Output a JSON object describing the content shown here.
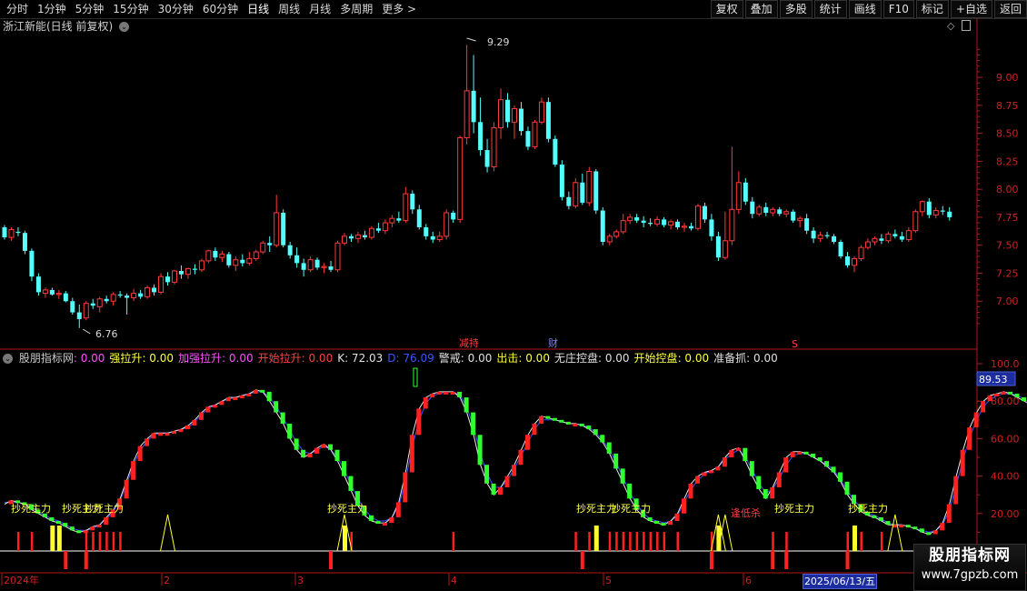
{
  "toolbar": {
    "periods": [
      "分时",
      "1分钟",
      "5分钟",
      "15分钟",
      "30分钟",
      "60分钟",
      "日线",
      "周线",
      "月线",
      "多周期",
      "更多 >"
    ],
    "active_period": "日线",
    "buttons": [
      "复权",
      "叠加",
      "多股",
      "统计",
      "画线",
      "F10",
      "标记",
      "+自选",
      "返回"
    ]
  },
  "main_chart": {
    "title": "浙江新能(日线 前复权)",
    "price_ticks": [
      "9.00",
      "8.75",
      "8.50",
      "8.25",
      "8.00",
      "7.75",
      "7.50",
      "7.25",
      "7.00"
    ],
    "price_range": [
      6.75,
      9.35
    ],
    "high_label": "9.29",
    "low_label": "6.76",
    "markers": [
      "减持",
      "财",
      "S"
    ]
  },
  "indicator": {
    "title_items": [
      {
        "label": "股朋指标网",
        "value": ": 0.00",
        "color": "#ff50ff",
        "label_color": "#c8c8c8"
      },
      {
        "label": "强拉升",
        "value": ": 0.00",
        "color": "#ffff40",
        "label_color": "#ffff40"
      },
      {
        "label": "加强拉升",
        "value": ": 0.00",
        "color": "#ff50ff",
        "label_color": "#ff50ff"
      },
      {
        "label": "开始拉升",
        "value": ": 0.00",
        "color": "#ff4040",
        "label_color": "#ff4040"
      },
      {
        "label": "K",
        "value": ": 72.03",
        "color": "#e0e0e0",
        "label_color": "#e0e0e0"
      },
      {
        "label": "D",
        "value": ": 76.09",
        "color": "#3a55ff",
        "label_color": "#3a55ff"
      },
      {
        "label": "警戒",
        "value": ": 0.00",
        "color": "#e0e0e0",
        "label_color": "#e0e0e0"
      },
      {
        "label": "出击",
        "value": ": 0.00",
        "color": "#ffff40",
        "label_color": "#ffff40"
      },
      {
        "label": "无庄控盘",
        "value": ": 0.00",
        "color": "#e0e0e0",
        "label_color": "#e0e0e0"
      },
      {
        "label": "开始控盘",
        "value": ": 0.00",
        "color": "#ffff40",
        "label_color": "#ffff40"
      },
      {
        "label": "准备抓",
        "value": ": 0.00",
        "color": "#e0e0e0",
        "label_color": "#e0e0e0"
      }
    ],
    "ticks": [
      "100.0",
      "80.00",
      "60.00",
      "40.00",
      "20.00"
    ],
    "current_value": "89.53",
    "signals": [
      "抄死主力",
      "抄死主力",
      "抄死主力",
      "抄死主力",
      "抄死主力",
      "抄死主力",
      "抄死主力",
      "逢低杀"
    ]
  },
  "x_axis": {
    "labels": [
      "2024年",
      "2",
      "3",
      "4",
      "5",
      "6"
    ],
    "cursor_date": "2025/06/13/五"
  },
  "watermark": {
    "name": "股朋指标网",
    "url": "www.7gpzb.com"
  },
  "colors": {
    "up": "#ff3a3a",
    "down": "#54ffff",
    "axis": "#b01818",
    "text_red": "#d02020"
  },
  "chart_data": {
    "type": "candlestick",
    "title": "浙江新能(日线 前复权)",
    "y_ticks": [
      9.0,
      8.75,
      8.5,
      8.25,
      8.0,
      7.75,
      7.5,
      7.25,
      7.0
    ],
    "x_labels": [
      "2024年",
      "2",
      "3",
      "4",
      "5",
      "6"
    ],
    "candles": [
      [
        7.66,
        7.68,
        7.55,
        7.57
      ],
      [
        7.57,
        7.66,
        7.54,
        7.64
      ],
      [
        7.62,
        7.66,
        7.58,
        7.61
      ],
      [
        7.61,
        7.63,
        7.42,
        7.45
      ],
      [
        7.45,
        7.47,
        7.18,
        7.22
      ],
      [
        7.22,
        7.25,
        7.05,
        7.08
      ],
      [
        7.07,
        7.12,
        7.03,
        7.1
      ],
      [
        7.1,
        7.12,
        7.05,
        7.06
      ],
      [
        7.06,
        7.1,
        7.02,
        7.07
      ],
      [
        7.07,
        7.09,
        6.99,
        7.0
      ],
      [
        7.0,
        7.03,
        6.88,
        6.9
      ],
      [
        6.9,
        6.97,
        6.76,
        6.84
      ],
      [
        6.85,
        7.0,
        6.83,
        6.98
      ],
      [
        6.98,
        7.02,
        6.93,
        6.96
      ],
      [
        6.95,
        7.04,
        6.9,
        7.02
      ],
      [
        7.02,
        7.05,
        6.98,
        7.0
      ],
      [
        7.0,
        7.08,
        6.96,
        7.06
      ],
      [
        7.06,
        7.09,
        7.03,
        7.05
      ],
      [
        7.05,
        7.07,
        6.88,
        7.03
      ],
      [
        7.03,
        7.11,
        7.0,
        7.07
      ],
      [
        7.07,
        7.1,
        7.02,
        7.04
      ],
      [
        7.04,
        7.14,
        7.02,
        7.12
      ],
      [
        7.12,
        7.15,
        7.05,
        7.08
      ],
      [
        7.08,
        7.25,
        7.06,
        7.22
      ],
      [
        7.22,
        7.26,
        7.14,
        7.17
      ],
      [
        7.17,
        7.28,
        7.15,
        7.27
      ],
      [
        7.27,
        7.32,
        7.2,
        7.24
      ],
      [
        7.24,
        7.3,
        7.2,
        7.29
      ],
      [
        7.29,
        7.33,
        7.24,
        7.28
      ],
      [
        7.28,
        7.38,
        7.26,
        7.36
      ],
      [
        7.36,
        7.46,
        7.34,
        7.45
      ],
      [
        7.45,
        7.48,
        7.36,
        7.39
      ],
      [
        7.39,
        7.45,
        7.35,
        7.42
      ],
      [
        7.42,
        7.44,
        7.3,
        7.32
      ],
      [
        7.32,
        7.4,
        7.27,
        7.37
      ],
      [
        7.37,
        7.42,
        7.31,
        7.34
      ],
      [
        7.34,
        7.44,
        7.32,
        7.38
      ],
      [
        7.38,
        7.46,
        7.36,
        7.44
      ],
      [
        7.44,
        7.54,
        7.42,
        7.52
      ],
      [
        7.52,
        7.58,
        7.44,
        7.5
      ],
      [
        7.5,
        7.95,
        7.48,
        7.79
      ],
      [
        7.79,
        7.82,
        7.48,
        7.5
      ],
      [
        7.5,
        7.53,
        7.38,
        7.41
      ],
      [
        7.41,
        7.48,
        7.3,
        7.34
      ],
      [
        7.34,
        7.38,
        7.22,
        7.28
      ],
      [
        7.28,
        7.4,
        7.26,
        7.37
      ],
      [
        7.37,
        7.39,
        7.28,
        7.3
      ],
      [
        7.3,
        7.34,
        7.25,
        7.31
      ],
      [
        7.31,
        7.36,
        7.26,
        7.28
      ],
      [
        7.28,
        7.54,
        7.26,
        7.52
      ],
      [
        7.52,
        7.61,
        7.5,
        7.58
      ],
      [
        7.58,
        7.6,
        7.53,
        7.56
      ],
      [
        7.56,
        7.62,
        7.52,
        7.59
      ],
      [
        7.59,
        7.63,
        7.55,
        7.57
      ],
      [
        7.57,
        7.67,
        7.55,
        7.65
      ],
      [
        7.65,
        7.7,
        7.61,
        7.63
      ],
      [
        7.63,
        7.73,
        7.6,
        7.7
      ],
      [
        7.7,
        7.77,
        7.66,
        7.74
      ],
      [
        7.74,
        7.8,
        7.7,
        7.72
      ],
      [
        7.72,
        8.02,
        7.7,
        7.96
      ],
      [
        7.96,
        7.99,
        7.78,
        7.82
      ],
      [
        7.82,
        7.86,
        7.64,
        7.66
      ],
      [
        7.66,
        7.69,
        7.55,
        7.58
      ],
      [
        7.58,
        7.62,
        7.52,
        7.55
      ],
      [
        7.55,
        7.62,
        7.53,
        7.58
      ],
      [
        7.58,
        7.82,
        7.55,
        7.79
      ],
      [
        7.79,
        7.81,
        7.7,
        7.73
      ],
      [
        7.73,
        8.48,
        7.7,
        8.46
      ],
      [
        8.46,
        9.29,
        8.4,
        8.88
      ],
      [
        8.88,
        9.2,
        8.5,
        8.6
      ],
      [
        8.6,
        8.82,
        8.3,
        8.35
      ],
      [
        8.35,
        8.45,
        8.15,
        8.2
      ],
      [
        8.2,
        8.6,
        8.16,
        8.55
      ],
      [
        8.55,
        8.9,
        8.45,
        8.8
      ],
      [
        8.8,
        8.86,
        8.55,
        8.6
      ],
      [
        8.6,
        8.75,
        8.45,
        8.72
      ],
      [
        8.72,
        8.78,
        8.48,
        8.52
      ],
      [
        8.52,
        8.56,
        8.35,
        8.38
      ],
      [
        8.38,
        8.62,
        8.36,
        8.6
      ],
      [
        8.6,
        8.82,
        8.58,
        8.78
      ],
      [
        8.78,
        8.82,
        8.42,
        8.45
      ],
      [
        8.45,
        8.48,
        8.2,
        8.22
      ],
      [
        8.22,
        8.26,
        7.9,
        7.93
      ],
      [
        7.93,
        7.98,
        7.82,
        7.85
      ],
      [
        7.85,
        8.1,
        7.83,
        8.06
      ],
      [
        8.06,
        8.14,
        7.86,
        7.88
      ],
      [
        7.88,
        8.2,
        7.85,
        8.16
      ],
      [
        8.16,
        8.18,
        7.78,
        7.81
      ],
      [
        7.81,
        7.84,
        7.5,
        7.53
      ],
      [
        7.53,
        7.6,
        7.5,
        7.58
      ],
      [
        7.58,
        7.64,
        7.56,
        7.62
      ],
      [
        7.62,
        7.78,
        7.6,
        7.72
      ],
      [
        7.72,
        7.78,
        7.69,
        7.75
      ],
      [
        7.75,
        7.78,
        7.7,
        7.72
      ],
      [
        7.72,
        7.76,
        7.66,
        7.7
      ],
      [
        7.7,
        7.74,
        7.67,
        7.69
      ],
      [
        7.69,
        7.76,
        7.67,
        7.73
      ],
      [
        7.73,
        7.75,
        7.66,
        7.68
      ],
      [
        7.68,
        7.73,
        7.64,
        7.71
      ],
      [
        7.71,
        7.73,
        7.64,
        7.66
      ],
      [
        7.66,
        7.7,
        7.62,
        7.67
      ],
      [
        7.67,
        7.7,
        7.63,
        7.65
      ],
      [
        7.65,
        7.87,
        7.63,
        7.85
      ],
      [
        7.85,
        7.88,
        7.7,
        7.73
      ],
      [
        7.73,
        7.78,
        7.54,
        7.58
      ],
      [
        7.58,
        7.62,
        7.36,
        7.39
      ],
      [
        7.39,
        7.8,
        7.37,
        7.54
      ],
      [
        7.54,
        8.38,
        7.5,
        7.82
      ],
      [
        7.82,
        8.16,
        7.78,
        8.06
      ],
      [
        8.06,
        8.1,
        7.86,
        7.89
      ],
      [
        7.89,
        7.93,
        7.74,
        7.78
      ],
      [
        7.78,
        7.86,
        7.76,
        7.84
      ],
      [
        7.84,
        7.88,
        7.76,
        7.79
      ],
      [
        7.79,
        7.84,
        7.76,
        7.82
      ],
      [
        7.82,
        7.84,
        7.76,
        7.78
      ],
      [
        7.78,
        7.82,
        7.75,
        7.8
      ],
      [
        7.8,
        7.82,
        7.7,
        7.72
      ],
      [
        7.72,
        7.76,
        7.66,
        7.74
      ],
      [
        7.74,
        7.78,
        7.6,
        7.63
      ],
      [
        7.63,
        7.66,
        7.52,
        7.56
      ],
      [
        7.56,
        7.62,
        7.53,
        7.59
      ],
      [
        7.59,
        7.62,
        7.56,
        7.58
      ],
      [
        7.58,
        7.6,
        7.51,
        7.53
      ],
      [
        7.53,
        7.55,
        7.38,
        7.4
      ],
      [
        7.4,
        7.44,
        7.3,
        7.32
      ],
      [
        7.32,
        7.4,
        7.26,
        7.38
      ],
      [
        7.38,
        7.5,
        7.36,
        7.48
      ],
      [
        7.48,
        7.56,
        7.46,
        7.53
      ],
      [
        7.53,
        7.58,
        7.5,
        7.56
      ],
      [
        7.56,
        7.6,
        7.51,
        7.54
      ],
      [
        7.54,
        7.62,
        7.52,
        7.6
      ],
      [
        7.6,
        7.64,
        7.56,
        7.58
      ],
      [
        7.58,
        7.62,
        7.53,
        7.55
      ],
      [
        7.55,
        7.66,
        7.53,
        7.63
      ],
      [
        7.63,
        7.82,
        7.61,
        7.8
      ],
      [
        7.8,
        7.9,
        7.76,
        7.89
      ],
      [
        7.89,
        7.92,
        7.74,
        7.77
      ],
      [
        7.77,
        7.84,
        7.74,
        7.81
      ],
      [
        7.81,
        7.85,
        7.77,
        7.8
      ],
      [
        7.8,
        7.84,
        7.72,
        7.75
      ]
    ],
    "k_line": [
      25,
      27,
      26,
      25,
      22,
      20,
      18,
      16,
      15,
      13,
      11,
      10,
      11,
      13,
      14,
      18,
      22,
      28,
      38,
      48,
      56,
      60,
      63,
      63,
      63,
      64,
      65,
      67,
      70,
      74,
      77,
      78,
      80,
      82,
      82,
      83,
      84,
      86,
      85,
      80,
      74,
      68,
      60,
      54,
      50,
      52,
      55,
      57,
      54,
      48,
      40,
      32,
      24,
      19,
      16,
      15,
      15,
      18,
      26,
      42,
      62,
      76,
      82,
      84,
      85,
      85,
      85,
      82,
      74,
      62,
      46,
      36,
      30,
      34,
      40,
      46,
      54,
      62,
      68,
      72,
      71,
      70,
      69,
      68,
      68,
      67,
      65,
      62,
      58,
      52,
      44,
      36,
      28,
      22,
      18,
      16,
      15,
      14,
      16,
      20,
      28,
      36,
      40,
      42,
      43,
      45,
      50,
      54,
      55,
      48,
      40,
      33,
      28,
      34,
      42,
      50,
      53,
      53,
      52,
      50,
      48,
      45,
      42,
      37,
      30,
      25,
      21,
      19,
      18,
      16,
      14,
      14,
      14,
      13,
      12,
      10,
      9,
      11,
      15,
      25,
      40,
      54,
      66,
      74,
      80,
      83,
      84,
      85,
      84,
      82,
      80,
      78,
      75,
      72
    ],
    "d_line": [
      26,
      26,
      26,
      25,
      23,
      21,
      19,
      17,
      16,
      14,
      12,
      11,
      11,
      12,
      14,
      17,
      21,
      27,
      36,
      46,
      54,
      59,
      62,
      63,
      63,
      64,
      65,
      66,
      69,
      73,
      76,
      78,
      80,
      81,
      82,
      83,
      84,
      85,
      85,
      82,
      77,
      71,
      64,
      58,
      53,
      52,
      54,
      56,
      54,
      50,
      43,
      35,
      28,
      22,
      18,
      16,
      16,
      18,
      24,
      38,
      56,
      70,
      79,
      83,
      84,
      85,
      85,
      83,
      77,
      66,
      52,
      41,
      34,
      34,
      38,
      44,
      51,
      58,
      65,
      70,
      70,
      70,
      69,
      68,
      68,
      67,
      66,
      63,
      59,
      54,
      47,
      39,
      31,
      25,
      20,
      17,
      16,
      15,
      16,
      19,
      26,
      33,
      38,
      41,
      43,
      45,
      49,
      52,
      54,
      50,
      43,
      36,
      31,
      33,
      39,
      46,
      51,
      52,
      52,
      50,
      48,
      46,
      43,
      38,
      32,
      27,
      23,
      20,
      19,
      17,
      15,
      14,
      14,
      13,
      12,
      11,
      10,
      11,
      14,
      22,
      35,
      49,
      61,
      70,
      77,
      81,
      83,
      84,
      84,
      83,
      81,
      79,
      76,
      73
    ]
  }
}
